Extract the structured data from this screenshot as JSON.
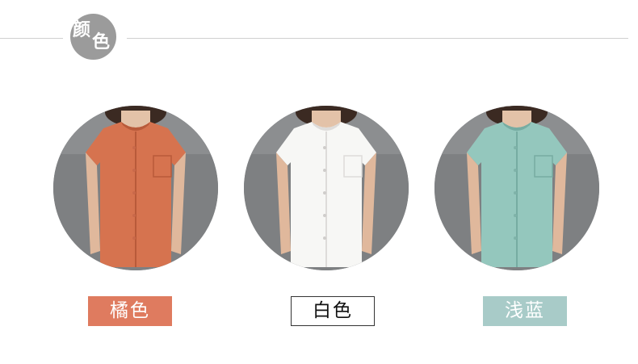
{
  "section": {
    "title_chars": [
      "颜",
      "色"
    ]
  },
  "colors": [
    {
      "label": "橘色",
      "shirt": "#d6734f",
      "shirt_shade": "#b85a3a"
    },
    {
      "label": "白色",
      "shirt": "#f7f7f5",
      "shirt_shade": "#dedcda"
    },
    {
      "label": "浅蓝",
      "shirt": "#94c7bd",
      "shirt_shade": "#76aca2"
    }
  ]
}
